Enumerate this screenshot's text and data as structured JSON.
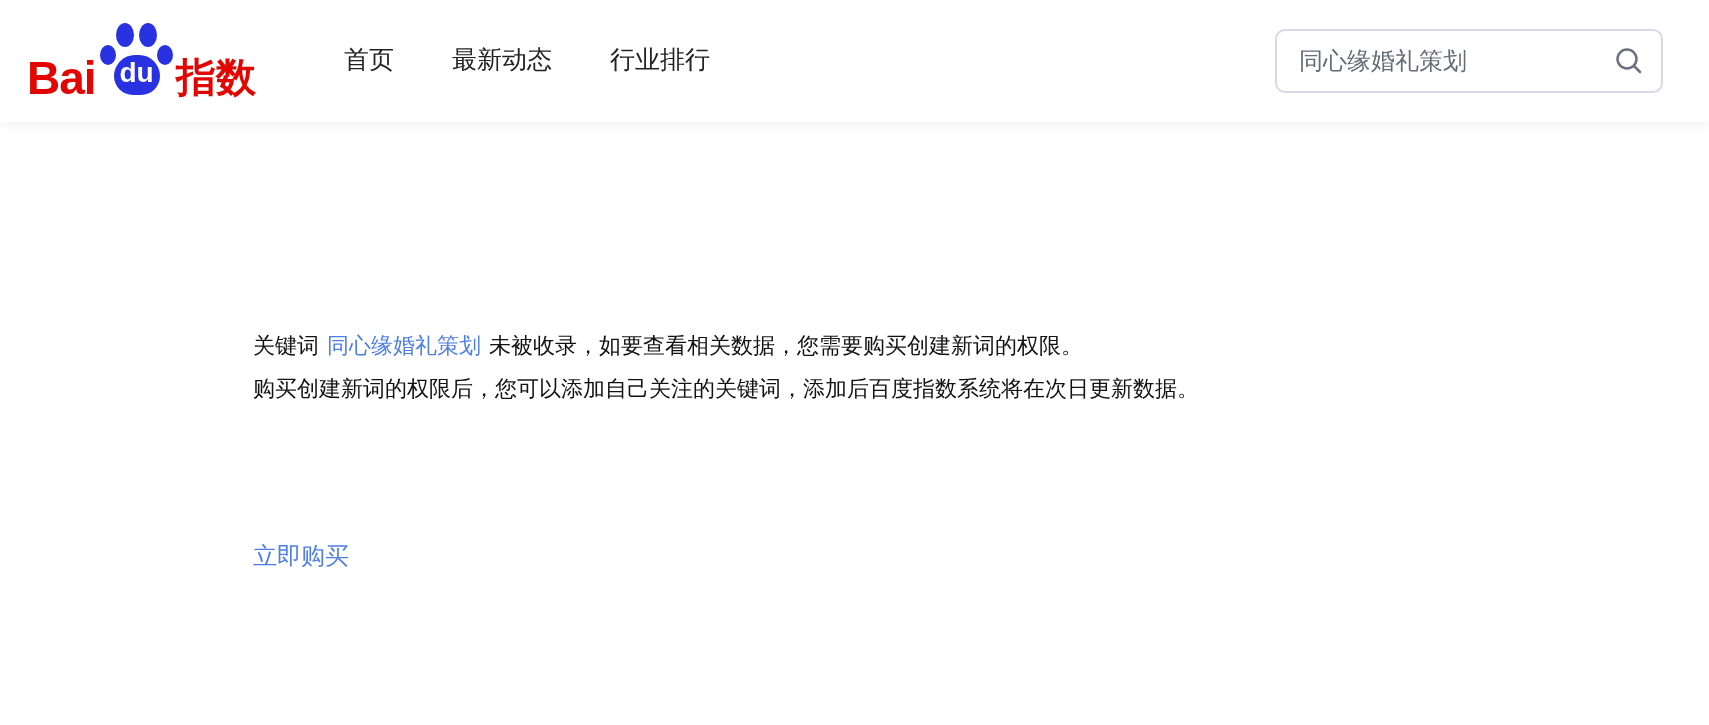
{
  "logo": {
    "brand": "Bai",
    "badge": "du",
    "suffix": "指数"
  },
  "nav": [
    {
      "label": "首页",
      "selected": false
    },
    {
      "label": "最新动态",
      "selected": false
    },
    {
      "label": "行业排行",
      "selected": false
    }
  ],
  "search": {
    "value": "同心缘婚礼策划"
  },
  "notice": {
    "prefix": "关键词",
    "keyword": "同心缘婚礼策划",
    "suffix": "未被收录，如要查看相关数据，您需要购买创建新词的权限。",
    "detail": "购买创建新词的权限后，您可以添加自己关注的关键词，添加后百度指数系统将在次日更新数据。"
  },
  "buy_link": "立即购买"
}
